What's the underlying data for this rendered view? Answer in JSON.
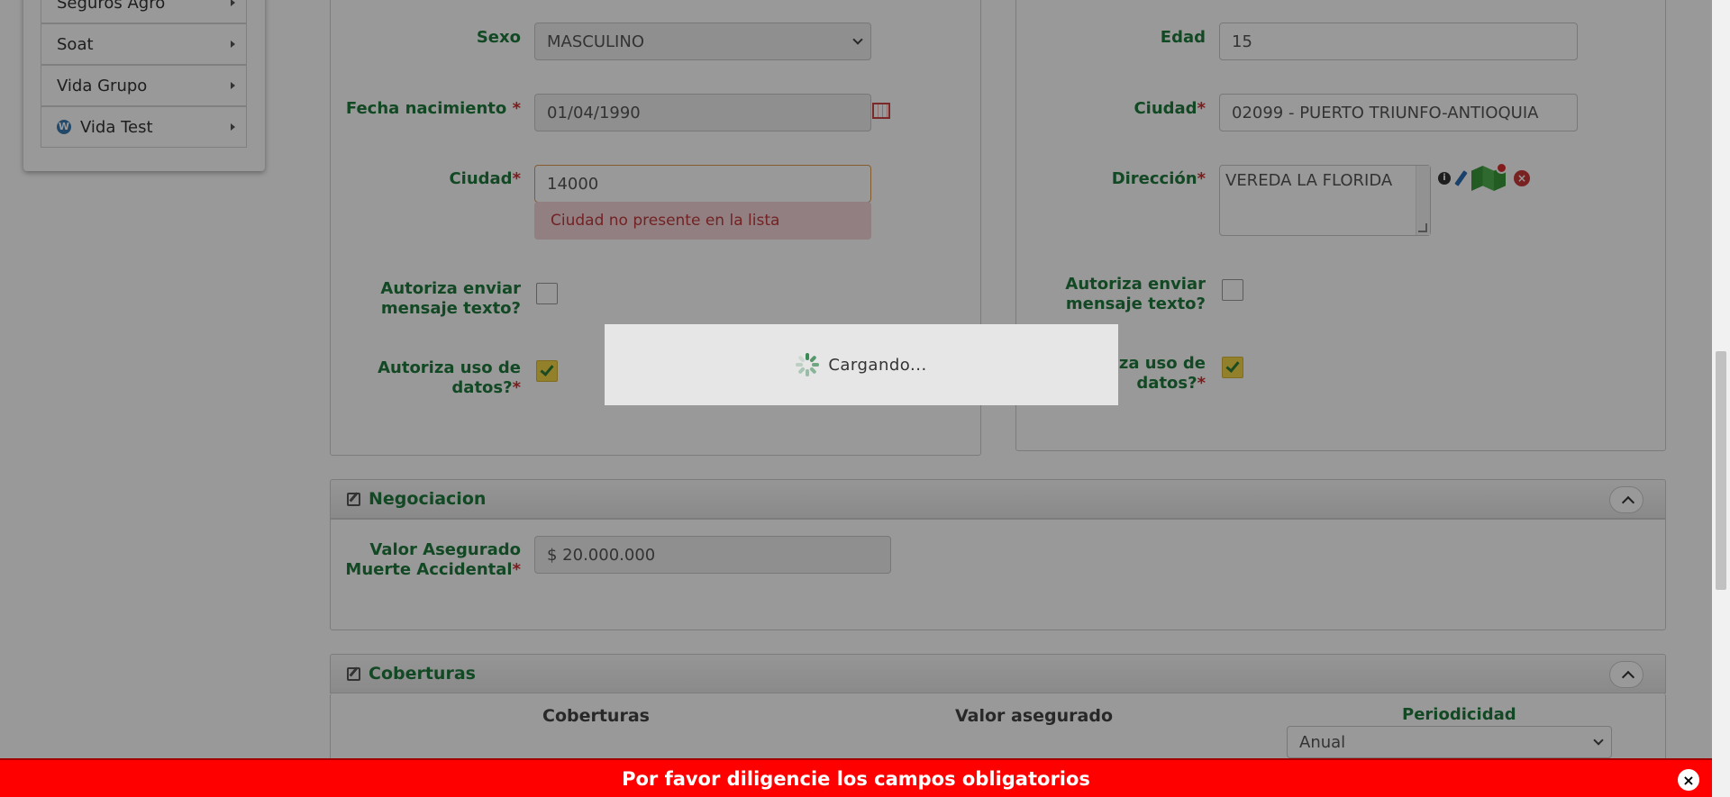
{
  "sidebar": {
    "items": [
      {
        "label": "Seguros Agro",
        "icon": ""
      },
      {
        "label": "Soat",
        "icon": ""
      },
      {
        "label": "Vida Grupo",
        "icon": ""
      },
      {
        "label": "Vida Test",
        "icon": "wordpress-icon"
      }
    ]
  },
  "left_form": {
    "sexo_label": "Sexo",
    "sexo_value": "MASCULINO",
    "fecha_label": "Fecha nacimiento",
    "fecha_value": "01/04/1990",
    "ciudad_label": "Ciudad",
    "ciudad_value": "14000",
    "ciudad_error": "Ciudad no presente en la lista",
    "sms_label_1": "Autoriza enviar",
    "sms_label_2": "mensaje texto?",
    "datos_label_1": "Autoriza uso de",
    "datos_label_2": "datos?",
    "required_mark": "*"
  },
  "right_form": {
    "edad_label": "Edad",
    "edad_value": "15",
    "ciudad_label": "Ciudad",
    "ciudad_value": "02099 - PUERTO TRIUNFO-ANTIOQUIA",
    "direccion_label": "Dirección",
    "direccion_value": "VEREDA LA FLORIDA",
    "sms_label_1": "Autoriza enviar",
    "sms_label_2": "mensaje texto?",
    "datos_label_1": "Autoriza uso de",
    "datos_label_2": "datos?",
    "required_mark": "*"
  },
  "negociacion": {
    "title": "Negociacion",
    "valor_label_1": "Valor Asegurado",
    "valor_label_2": "Muerte Accidental",
    "valor_value": "$ 20.000.000"
  },
  "coberturas": {
    "title": "Coberturas",
    "col_coberturas": "Coberturas",
    "col_valor": "Valor asegurado",
    "col_periodicidad": "Periodicidad",
    "periodicidad_value": "Anual"
  },
  "loading": {
    "text": "Cargando..."
  },
  "alert": {
    "text": "Por favor diligencie los campos obligatorios",
    "close": "×"
  },
  "colors": {
    "label_green": "#1e7b3c",
    "alert_red": "#ff0000",
    "required_red": "#d0302f"
  }
}
